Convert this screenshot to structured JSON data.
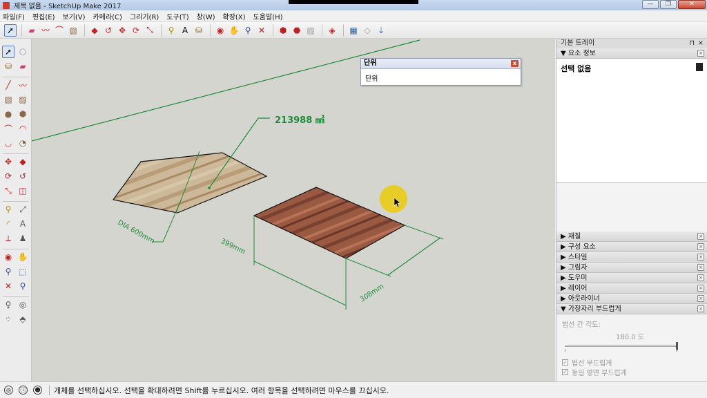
{
  "window": {
    "title": "제목 없음 - SketchUp Make 2017",
    "controls": {
      "minimize": "—",
      "maximize": "❐",
      "close": "✕"
    }
  },
  "menu": [
    "파일(F)",
    "편집(E)",
    "보기(V)",
    "카메라(C)",
    "그리기(R)",
    "도구(T)",
    "창(W)",
    "확장(X)",
    "도움말(H)"
  ],
  "toolbar": {
    "icons": [
      "select-icon",
      "eraser-icon",
      "freehand-icon",
      "arc-icon",
      "rectangle-icon",
      "pushpull-icon",
      "followme-icon",
      "move-icon",
      "rotate-icon",
      "scale-icon",
      "tape-measure-icon",
      "text-icon",
      "paint-bucket-icon",
      "orbit-icon",
      "pan-icon",
      "zoom-icon",
      "zoom-extents-icon",
      "warehouse-icon",
      "extension-warehouse-icon",
      "layout-icon",
      "send-to-layout-icon",
      "section-icon",
      "components-icon",
      "styles-icon"
    ]
  },
  "units_dialog": {
    "title": "단위",
    "body": "단위",
    "close": "x"
  },
  "viewport": {
    "area_label": "213988 ㎟",
    "dim_top_left": "DIA 600mm",
    "dim_depth": "399mm",
    "dim_width": "308mm"
  },
  "tray": {
    "title": "기본 트레이",
    "pin": "⊓",
    "close": "×",
    "entity_info": {
      "header": "▼ 요소 정보",
      "none": "선택 없음"
    },
    "panels": [
      {
        "label": "▶ 재질"
      },
      {
        "label": "▶ 구성 요소"
      },
      {
        "label": "▶ 스타일"
      },
      {
        "label": "▶ 그림자"
      },
      {
        "label": "▶ 도우미"
      },
      {
        "label": "▶ 레이어"
      },
      {
        "label": "▶ 아웃라이너"
      }
    ],
    "soften": {
      "header": "▼ 가장자리 부드럽게",
      "angle_label": "법선 간 각도:",
      "angle_value": "180.0 도",
      "slider_fraction": 1.0,
      "smooth_normals": "법선 부드럽게",
      "coplanar": "동일 평면 부드럽게"
    }
  },
  "status": {
    "text": "개체를 선택하십시오. 선택을 확대하려면 Shift를 누르십시오. 여러 항목을 선택하려면 마우스를 끄십시오."
  },
  "colors": {
    "dim_green": "#1f8c3b",
    "tray_bg": "#f3f3f3",
    "viewport_bg": "#d5d5d0",
    "cursor_highlight": "#e9cc12"
  }
}
